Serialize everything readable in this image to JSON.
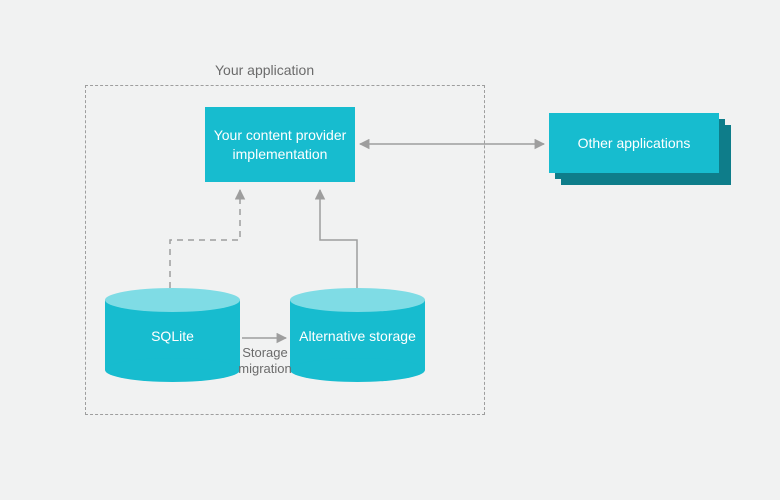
{
  "container": {
    "label": "Your application"
  },
  "provider": {
    "label": "Your content provider implementation"
  },
  "other_apps": {
    "label": "Other applications"
  },
  "storage": {
    "sqlite": "SQLite",
    "alternative": "Alternative storage",
    "migration_label": "Storage migration"
  },
  "colors": {
    "accent": "#17bccf",
    "accent_light": "#7fdce5",
    "accent_dark": "#0e7d8a",
    "bg": "#f1f2f2",
    "line": "#9e9e9e"
  }
}
